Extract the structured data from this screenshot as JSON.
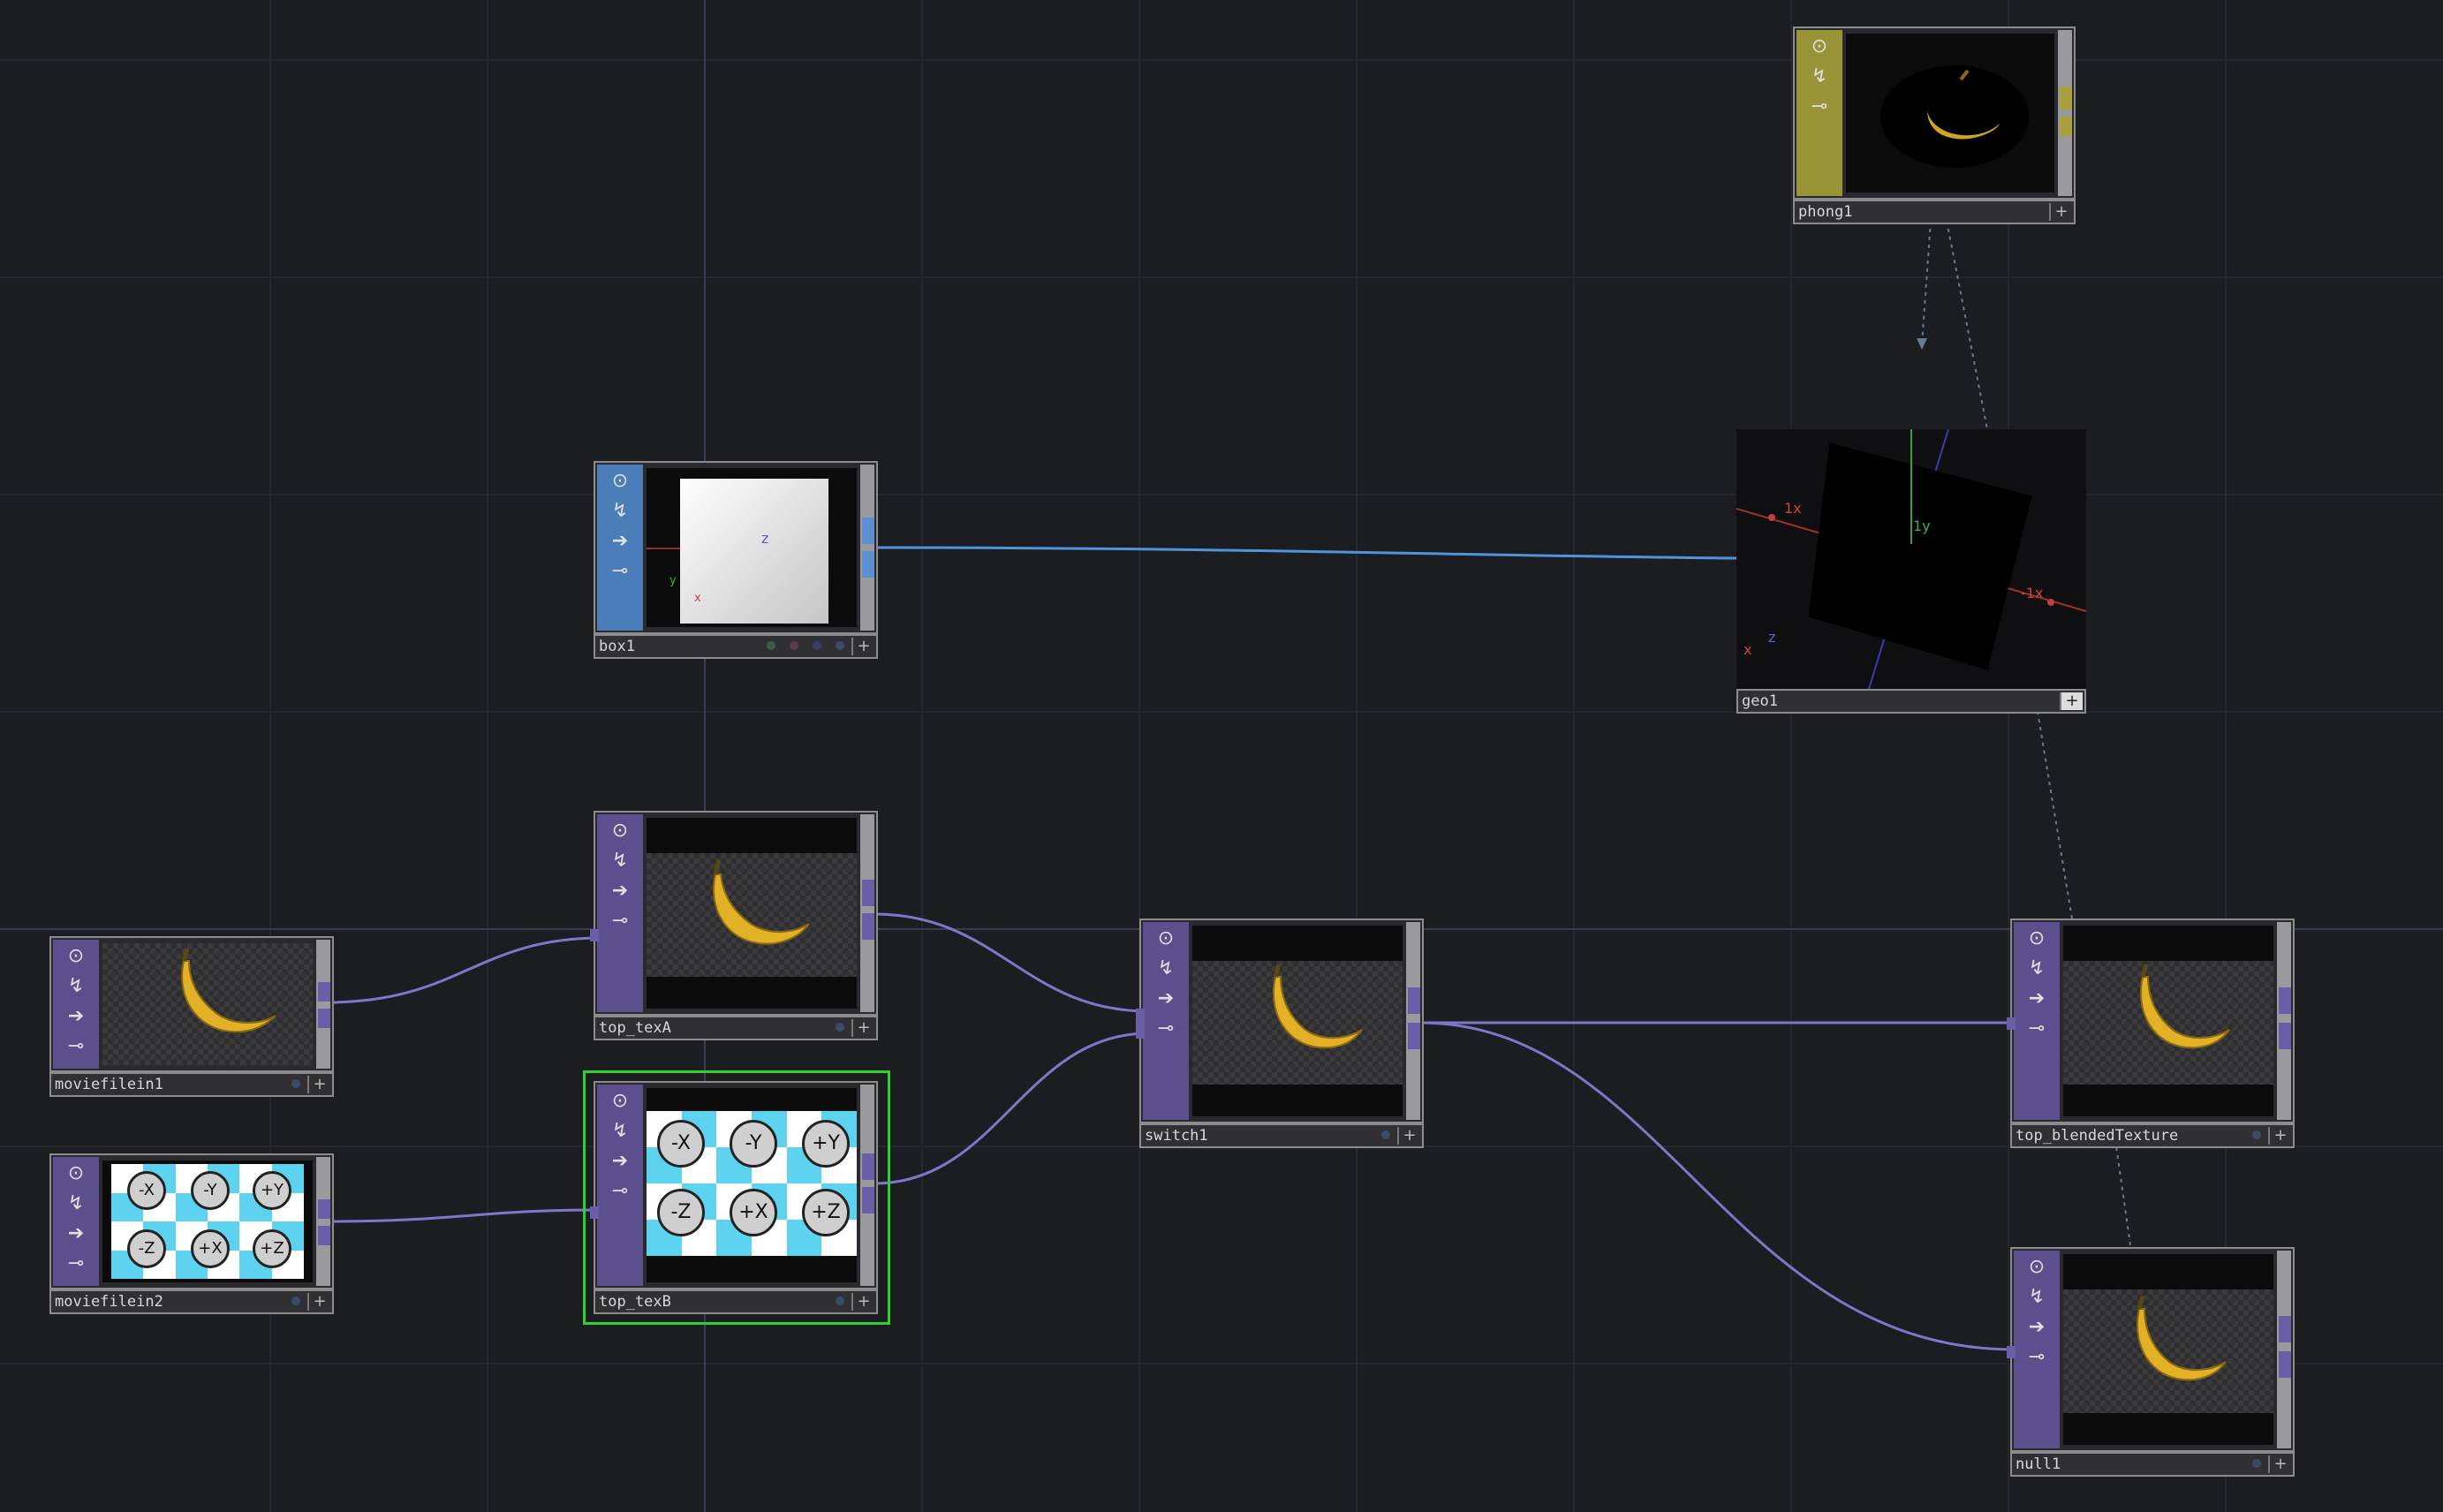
{
  "network": {
    "nodes": [
      {
        "id": "phong1",
        "name": "phong1",
        "family": "MAT"
      },
      {
        "id": "box1",
        "name": "box1",
        "family": "SOP"
      },
      {
        "id": "geo1",
        "name": "geo1",
        "family": "COMP"
      },
      {
        "id": "top_texA",
        "name": "top_texA",
        "family": "TOP"
      },
      {
        "id": "moviefilein1",
        "name": "moviefilein1",
        "family": "TOP"
      },
      {
        "id": "moviefilein2",
        "name": "moviefilein2",
        "family": "TOP"
      },
      {
        "id": "top_texB",
        "name": "top_texB",
        "family": "TOP",
        "selected": true
      },
      {
        "id": "switch1",
        "name": "switch1",
        "family": "TOP"
      },
      {
        "id": "top_blendedTexture",
        "name": "top_blendedTexture",
        "family": "TOP"
      },
      {
        "id": "null1",
        "name": "null1",
        "family": "TOP"
      }
    ],
    "cubemap_faces": [
      "-X",
      "-Y",
      "+Y",
      "-Z",
      "+X",
      "+Z"
    ],
    "box_viewer_axes": {
      "z": "z",
      "y": "y",
      "x": "x"
    },
    "geo_viewer_axes": {
      "x_pos": "1x",
      "y_pos": "1y",
      "x_neg": "-1x",
      "z": "z",
      "x": "x"
    },
    "colors": {
      "top_family": "#5c4f8e",
      "sop_family": "#4b7db8",
      "mat_family": "#9a9438",
      "top_wire": "#8275c9",
      "sop_wire": "#4f95db",
      "selection": "#2fd12f",
      "background": "#1c1d21"
    },
    "node_flags": [
      "viewer-flag-icon",
      "bypass-flag-icon",
      "cook-flag-icon",
      "lock-flag-icon"
    ]
  }
}
